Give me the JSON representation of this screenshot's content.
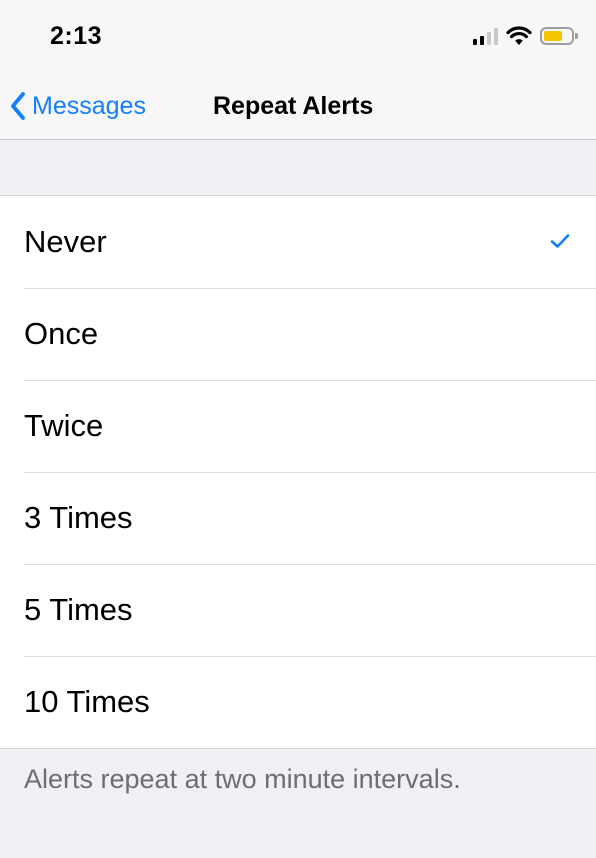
{
  "status_bar": {
    "time": "2:13",
    "icons": [
      "signal-icon",
      "wifi-icon",
      "battery-icon"
    ],
    "battery_color": "#f5c400"
  },
  "nav": {
    "back_label": "Messages",
    "title": "Repeat Alerts",
    "accent_color": "#147efb"
  },
  "options": [
    {
      "label": "Never",
      "selected": true
    },
    {
      "label": "Once",
      "selected": false
    },
    {
      "label": "Twice",
      "selected": false
    },
    {
      "label": "3 Times",
      "selected": false
    },
    {
      "label": "5 Times",
      "selected": false
    },
    {
      "label": "10 Times",
      "selected": false
    }
  ],
  "footer": {
    "note": "Alerts repeat at two minute intervals."
  }
}
